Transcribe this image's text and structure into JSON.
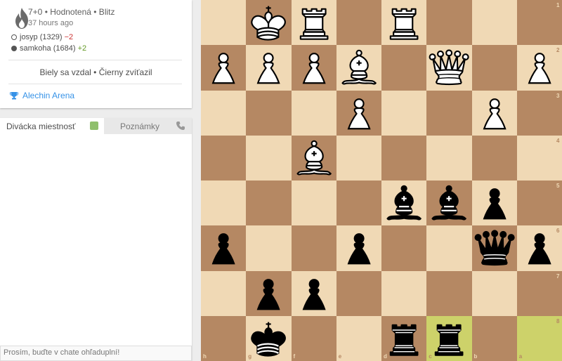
{
  "game": {
    "meta": "7+0 • Hodnotená • Blitz",
    "ago": "37 hours ago",
    "white_player": {
      "name": "josyp (1329)",
      "diff": "−2"
    },
    "black_player": {
      "name": "samkoha (1684)",
      "diff": "+2"
    },
    "status": "Biely sa vzdal • Čierny zvíťazil",
    "tournament": "Alechin Arena",
    "icon": "fire-icon"
  },
  "chat": {
    "tab_room": "Divácka miestnosť",
    "tab_notes": "Poznámky",
    "placeholder": "Prosím, buďte v chate ohľaduplní!"
  },
  "board": {
    "orientation": "black",
    "files": [
      "h",
      "g",
      "f",
      "e",
      "d",
      "c",
      "b",
      "a"
    ],
    "ranks": [
      "1",
      "2",
      "3",
      "4",
      "5",
      "6",
      "7",
      "8"
    ],
    "highlight": [
      "c8",
      "a8"
    ],
    "pieces": [
      {
        "sq": "g1",
        "p": "wK"
      },
      {
        "sq": "f1",
        "p": "wR"
      },
      {
        "sq": "d1",
        "p": "wR"
      },
      {
        "sq": "h2",
        "p": "wP"
      },
      {
        "sq": "g2",
        "p": "wP"
      },
      {
        "sq": "f2",
        "p": "wP"
      },
      {
        "sq": "e2",
        "p": "wB"
      },
      {
        "sq": "c2",
        "p": "wQ"
      },
      {
        "sq": "a2",
        "p": "wP"
      },
      {
        "sq": "e3",
        "p": "wP"
      },
      {
        "sq": "b3",
        "p": "wP"
      },
      {
        "sq": "f4",
        "p": "wB"
      },
      {
        "sq": "d5",
        "p": "bB"
      },
      {
        "sq": "c5",
        "p": "bB"
      },
      {
        "sq": "b5",
        "p": "bP"
      },
      {
        "sq": "h6",
        "p": "bP"
      },
      {
        "sq": "e6",
        "p": "bP"
      },
      {
        "sq": "b6",
        "p": "bQ"
      },
      {
        "sq": "a6",
        "p": "bP"
      },
      {
        "sq": "g7",
        "p": "bP"
      },
      {
        "sq": "f7",
        "p": "bP"
      },
      {
        "sq": "g8",
        "p": "bK"
      },
      {
        "sq": "d8",
        "p": "bR"
      },
      {
        "sq": "c8",
        "p": "bR"
      }
    ]
  }
}
